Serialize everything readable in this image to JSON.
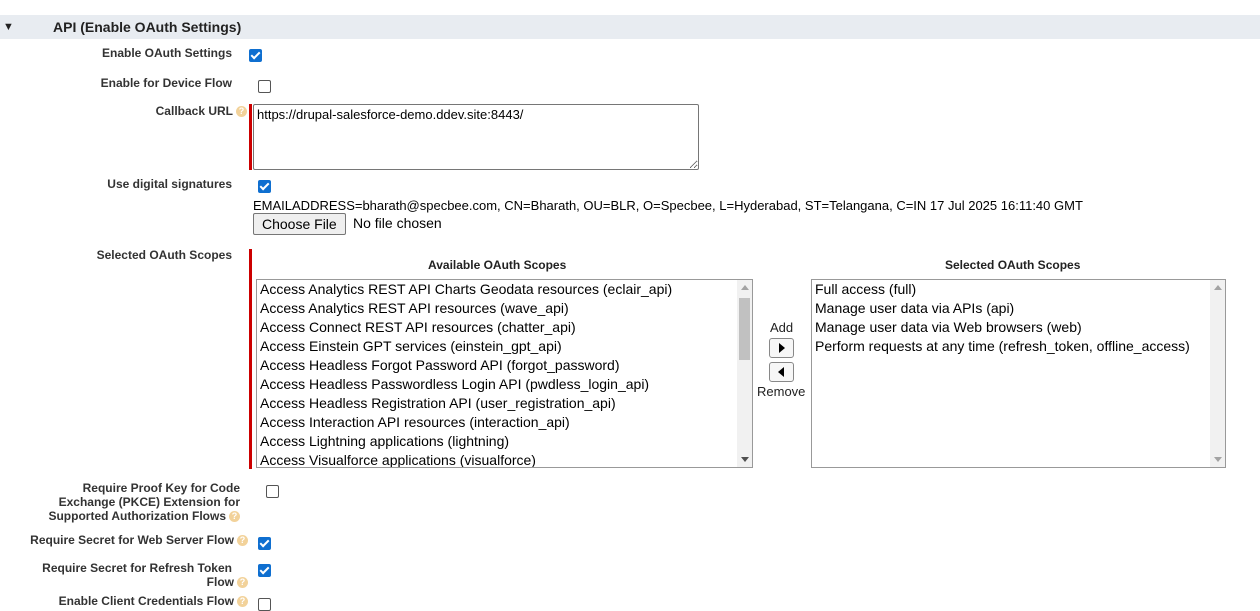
{
  "section": {
    "title": "API (Enable OAuth Settings)"
  },
  "fields": {
    "enable_oauth": {
      "label": "Enable OAuth Settings",
      "checked": true
    },
    "device_flow": {
      "label": "Enable for Device Flow",
      "checked": false
    },
    "callback_url": {
      "label": "Callback URL",
      "value": "https://drupal-salesforce-demo.ddev.site:8443/"
    },
    "digital_signatures": {
      "label": "Use digital signatures",
      "checked": true,
      "certificate": "EMAILADDRESS=bharath@specbee.com, CN=Bharath, OU=BLR, O=Specbee, L=Hyderabad, ST=Telangana, C=IN 17 Jul 2025 16:11:40 GMT",
      "choose_file_label": "Choose File",
      "no_file_text": "No file chosen"
    },
    "oauth_scopes": {
      "label": "Selected OAuth Scopes",
      "available_heading": "Available OAuth Scopes",
      "selected_heading": "Selected OAuth Scopes",
      "add_label": "Add",
      "remove_label": "Remove",
      "available": [
        "Access Analytics REST API Charts Geodata resources (eclair_api)",
        "Access Analytics REST API resources (wave_api)",
        "Access Connect REST API resources (chatter_api)",
        "Access Einstein GPT services (einstein_gpt_api)",
        "Access Headless Forgot Password API (forgot_password)",
        "Access Headless Passwordless Login API (pwdless_login_api)",
        "Access Headless Registration API (user_registration_api)",
        "Access Interaction API resources (interaction_api)",
        "Access Lightning applications (lightning)",
        "Access Visualforce applications (visualforce)"
      ],
      "selected": [
        "Full access (full)",
        "Manage user data via APIs (api)",
        "Manage user data via Web browsers (web)",
        "Perform requests at any time (refresh_token, offline_access)"
      ]
    },
    "pkce": {
      "label_lines": [
        "Require Proof Key for Code",
        "Exchange (PKCE) Extension for",
        "Supported Authorization Flows"
      ],
      "checked": false
    },
    "secret_web_server": {
      "label": "Require Secret for Web Server Flow",
      "checked": true
    },
    "secret_refresh": {
      "label_lines": [
        "Require Secret for Refresh Token",
        "Flow"
      ],
      "checked": true
    },
    "client_credentials": {
      "label": "Enable Client Credentials Flow",
      "checked": false
    }
  },
  "icons": {
    "help": "help-icon",
    "collapse": "triangle-down-icon"
  },
  "colors": {
    "accent": "#0f6fd0",
    "required_bar": "#cc0000",
    "header_bg": "#e8ecf1"
  }
}
